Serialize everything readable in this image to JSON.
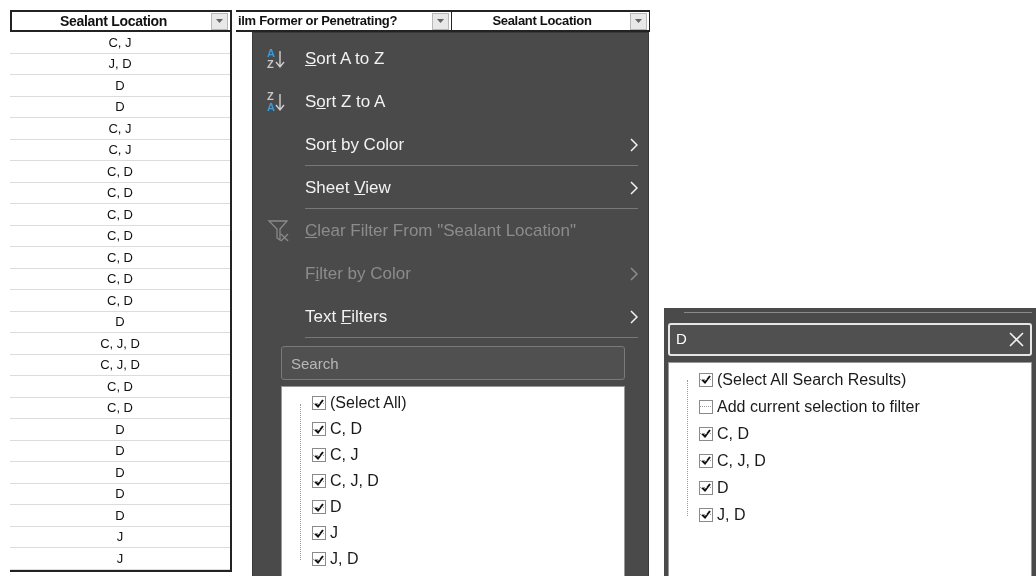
{
  "sheet": {
    "header": "Sealant Location",
    "cells": [
      "C, J",
      "J, D",
      "D",
      "D",
      "C, J",
      "C, J",
      "C, D",
      "C, D",
      "C, D",
      "C, D",
      "C, D",
      "C, D",
      "C, D",
      "D",
      "C, J, D",
      "C, J, D",
      "C, D",
      "C, D",
      "D",
      "D",
      "D",
      "D",
      "D",
      "J",
      "J"
    ]
  },
  "headers": [
    {
      "label": "ilm Former or Penetrating?"
    },
    {
      "label": "Sealant Location"
    }
  ],
  "filter_menu": {
    "items": [
      {
        "key": "S",
        "post": "ort A to Z",
        "icon": {
          "kind": "sort",
          "top": "A",
          "bottom": "Z"
        },
        "submenu": false,
        "disabled": false,
        "divider_after": false
      },
      {
        "pre": "S",
        "key": "o",
        "post": "rt Z to A",
        "icon": {
          "kind": "sort",
          "top": "Z",
          "bottom": "A"
        },
        "submenu": false,
        "disabled": false,
        "divider_after": false
      },
      {
        "pre": "Sor",
        "key": "t",
        "post": " by Color",
        "submenu": true,
        "disabled": false,
        "divider_after": true
      },
      {
        "pre": "Sheet ",
        "key": "V",
        "post": "iew",
        "submenu": true,
        "disabled": false,
        "divider_after": true
      },
      {
        "key": "C",
        "post": "lear Filter From \"Sealant Location\"",
        "icon": {
          "kind": "clear-filter"
        },
        "submenu": false,
        "disabled": true,
        "divider_after": false
      },
      {
        "pre": "F",
        "key": "i",
        "post": "lter by Color",
        "submenu": true,
        "disabled": true,
        "divider_after": false
      },
      {
        "pre": "Text ",
        "key": "F",
        "post": "ilters",
        "submenu": true,
        "disabled": false,
        "divider_after": true
      }
    ],
    "search": {
      "placeholder": "Search"
    },
    "values": [
      {
        "label": "(Select All)",
        "checked": true
      },
      {
        "label": "C, D",
        "checked": true
      },
      {
        "label": "C, J",
        "checked": true
      },
      {
        "label": "C, J, D",
        "checked": true
      },
      {
        "label": "D",
        "checked": true
      },
      {
        "label": "J",
        "checked": true
      },
      {
        "label": "J, D",
        "checked": true
      }
    ]
  },
  "search_panel": {
    "search": {
      "value": "D"
    },
    "values": [
      {
        "label": "(Select All Search Results)",
        "checked": true
      },
      {
        "label": "Add current selection to filter",
        "checked": false
      },
      {
        "label": "C, D",
        "checked": true
      },
      {
        "label": "C, J, D",
        "checked": true
      },
      {
        "label": "D",
        "checked": true
      },
      {
        "label": "J, D",
        "checked": true
      }
    ]
  }
}
